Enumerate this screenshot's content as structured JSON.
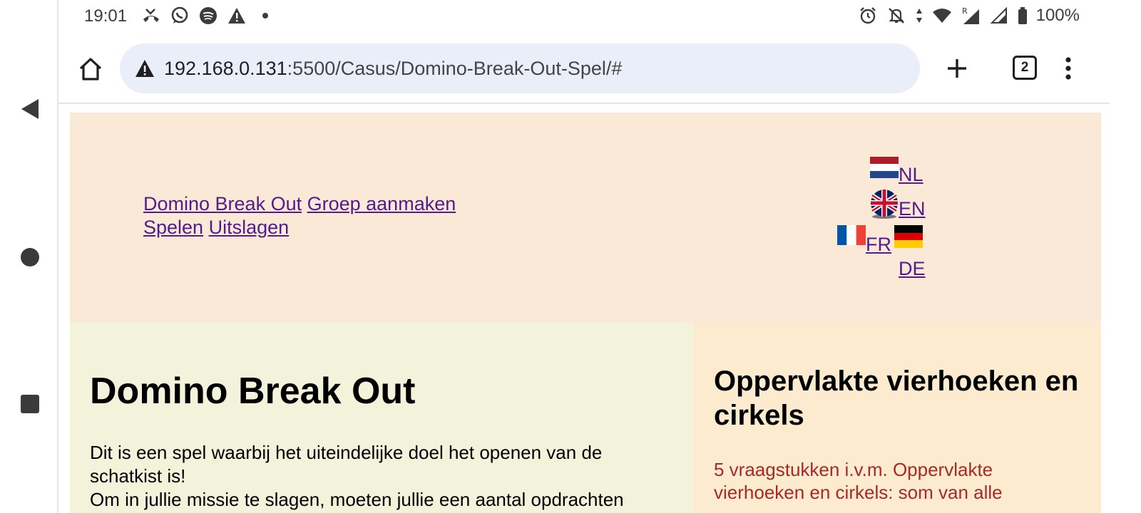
{
  "status_bar": {
    "time": "19:01",
    "battery": "100%",
    "left_icons": [
      "missed-call-icon",
      "whatsapp-icon",
      "spotify-icon",
      "alert-icon",
      "dot-icon"
    ],
    "right_icons": [
      "alarm-icon",
      "mute-icon",
      "data-arrows-icon",
      "wifi-icon",
      "signal-r-icon",
      "signal-icon",
      "battery-icon"
    ]
  },
  "browser": {
    "url_host": "192.168.0.131",
    "url_path": ":5500/Casus/Domino-Break-Out-Spel/#",
    "tab_count": "2"
  },
  "header": {
    "menu": {
      "home": "Domino Break Out",
      "create_group": "Groep aanmaken",
      "play": "Spelen",
      "results": "Uitslagen"
    },
    "languages": {
      "nl": "NL",
      "en": "EN",
      "fr": "FR",
      "de": "DE"
    }
  },
  "main": {
    "title": "Domino Break Out",
    "line1": "Dit is een spel waarbij het uiteindelijke doel het openen van de schatkist is!",
    "line2": "Om in jullie missie te slagen, moeten jullie een aantal opdrachten"
  },
  "aside": {
    "title": "Oppervlakte vierhoeken en cirkels",
    "text": "5 vraagstukken i.v.m. Oppervlakte vierhoeken en cirkels: som van alle"
  },
  "colors": {
    "header_bg": "#fae9d7",
    "main_bg": "#f3f3db",
    "aside_bg": "#fdebd0",
    "link": "#551a8b",
    "aside_text": "#a52a2a",
    "urlbar_bg": "#eaeef8"
  }
}
